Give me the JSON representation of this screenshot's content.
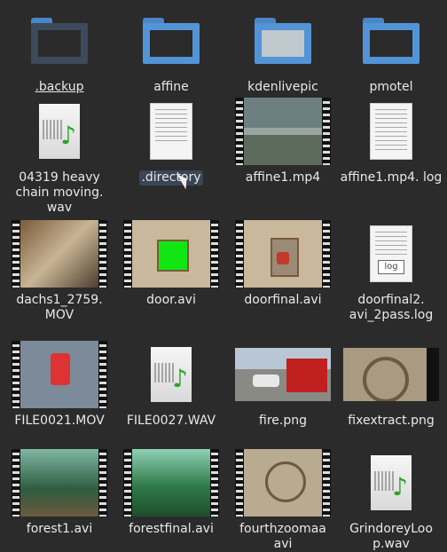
{
  "files": [
    {
      "name": ".backup",
      "kind": "folder-dark"
    },
    {
      "name": "affine",
      "kind": "folder"
    },
    {
      "name": "kdenlivepic",
      "kind": "folder"
    },
    {
      "name": "pmotel",
      "kind": "folder"
    },
    {
      "name": "04319 heavy chain moving. wav",
      "kind": "audio"
    },
    {
      "name": ".directory",
      "kind": "doc",
      "selected": true
    },
    {
      "name": "affine1.mp4",
      "kind": "video"
    },
    {
      "name": "affine1.mp4. log",
      "kind": "doc"
    },
    {
      "name": "dachs1_2759. MOV",
      "kind": "video"
    },
    {
      "name": "door.avi",
      "kind": "video"
    },
    {
      "name": "doorfinal.avi",
      "kind": "video"
    },
    {
      "name": "doorfinal2. avi_2pass.log",
      "kind": "log"
    },
    {
      "name": "FILE0021.MOV",
      "kind": "video"
    },
    {
      "name": "FILE0027.WAV",
      "kind": "audio"
    },
    {
      "name": "fire.png",
      "kind": "image"
    },
    {
      "name": "fixextract.png",
      "kind": "image"
    },
    {
      "name": "forest1.avi",
      "kind": "video"
    },
    {
      "name": "forestfinal.avi",
      "kind": "video"
    },
    {
      "name": "fourthzoomaa avi",
      "kind": "video"
    },
    {
      "name": "GrindoreyLoo p.wav",
      "kind": "audio"
    }
  ],
  "log_tag": "log",
  "colors": {
    "folder": "#5294d6",
    "background": "#2b2b2b"
  }
}
